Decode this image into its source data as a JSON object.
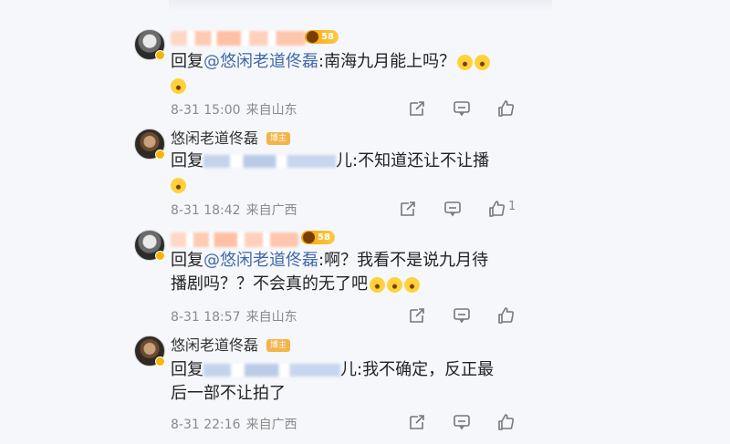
{
  "comments": [
    {
      "avatar": "dark-avatar",
      "level": "58",
      "text_prefix": "回复",
      "mention": "@悠闲老道佟磊",
      "text_rest": ":南海九月能上吗？",
      "meta_time": "8-31 15:00",
      "meta_location": "来自山东",
      "like_count": ""
    },
    {
      "avatar": "old-avatar",
      "name": "悠闲老道佟磊",
      "tag": "博主",
      "text_prefix": "回复",
      "text_rest": "儿:不知道还让不让播",
      "meta_time": "8-31 18:42",
      "meta_location": "来自广西",
      "like_count": "1"
    },
    {
      "avatar": "dark-avatar",
      "level": "58",
      "text_prefix": "回复",
      "mention": "@悠闲老道佟磊",
      "text_rest": ":啊？我看不是说九月待",
      "text_line2": "播剧吗？？不会真的无了吧",
      "meta_time": "8-31 18:57",
      "meta_location": "来自山东",
      "like_count": ""
    },
    {
      "avatar": "old-avatar",
      "name": "悠闲老道佟磊",
      "tag": "博主",
      "text_prefix": "回复",
      "text_rest": "儿:我不确定，反正最",
      "text_line2": "后一部不让拍了",
      "meta_time": "8-31 22:16",
      "meta_location": "来自广西",
      "like_count": ""
    }
  ]
}
